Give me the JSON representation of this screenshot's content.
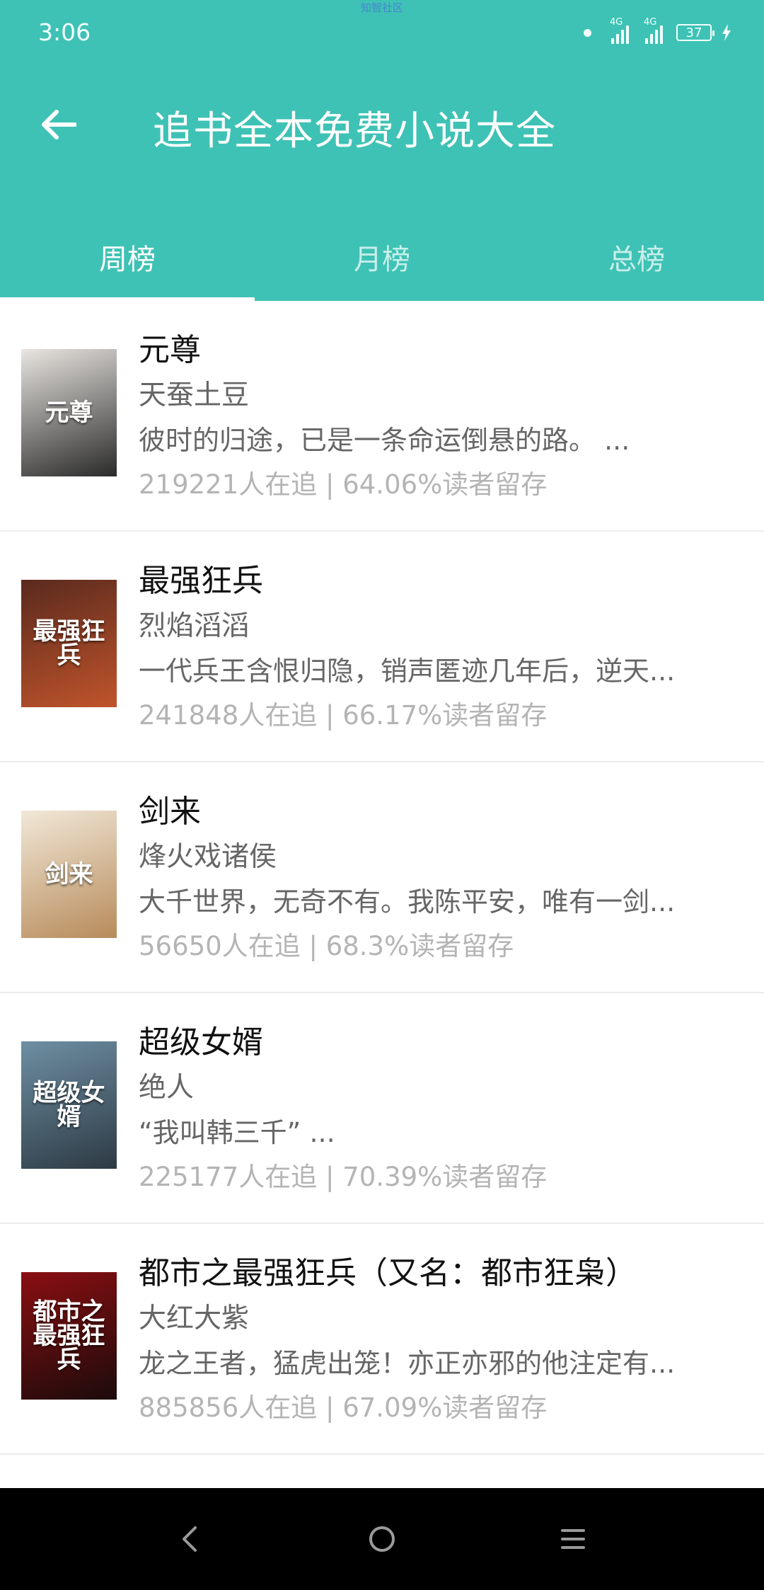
{
  "watermark": "知智社区",
  "status_bar": {
    "time": "3:06",
    "signal1_label": "4G",
    "signal2_label": "4G",
    "battery": "37"
  },
  "app_bar": {
    "title": "追书全本免费小说大全"
  },
  "tabs": [
    {
      "label": "周榜",
      "active": true
    },
    {
      "label": "月榜",
      "active": false
    },
    {
      "label": "总榜",
      "active": false
    }
  ],
  "books": [
    {
      "title": "元尊",
      "author": "天蚕土豆",
      "desc": "彼时的归途，已是一条命运倒悬的路。 ...",
      "stats": "219221人在追 | 64.06%读者留存",
      "cover_text": "元尊",
      "cover_colors": [
        "#e9e6e1",
        "#2a2a2a"
      ]
    },
    {
      "title": "最强狂兵",
      "author": "烈焰滔滔",
      "desc": "一代兵王含恨归隐，销声匿迹几年后，逆天...",
      "stats": "241848人在追 | 66.17%读者留存",
      "cover_text": "最强狂兵",
      "cover_colors": [
        "#5a2a1e",
        "#c0542b"
      ]
    },
    {
      "title": "剑来",
      "author": "烽火戏诸侯",
      "desc": "大千世界，无奇不有。我陈平安，唯有一剑...",
      "stats": "56650人在追 | 68.3%读者留存",
      "cover_text": "剑来",
      "cover_colors": [
        "#f1e8d8",
        "#b78b5a"
      ]
    },
    {
      "title": "超级女婿",
      "author": "绝人",
      "desc": "“我叫韩三千” ...",
      "stats": "225177人在追 | 70.39%读者留存",
      "cover_text": "超级女婿",
      "cover_colors": [
        "#6e8fa3",
        "#2d3a44"
      ]
    },
    {
      "title": "都市之最强狂兵（又名：都市狂枭）",
      "author": "大红大紫",
      "desc": "龙之王者，猛虎出笼！亦正亦邪的他注定有...",
      "stats": "885856人在追 | 67.09%读者留存",
      "cover_text": "都市之最强狂兵",
      "cover_colors": [
        "#8a0f12",
        "#1c0b0b"
      ]
    }
  ]
}
